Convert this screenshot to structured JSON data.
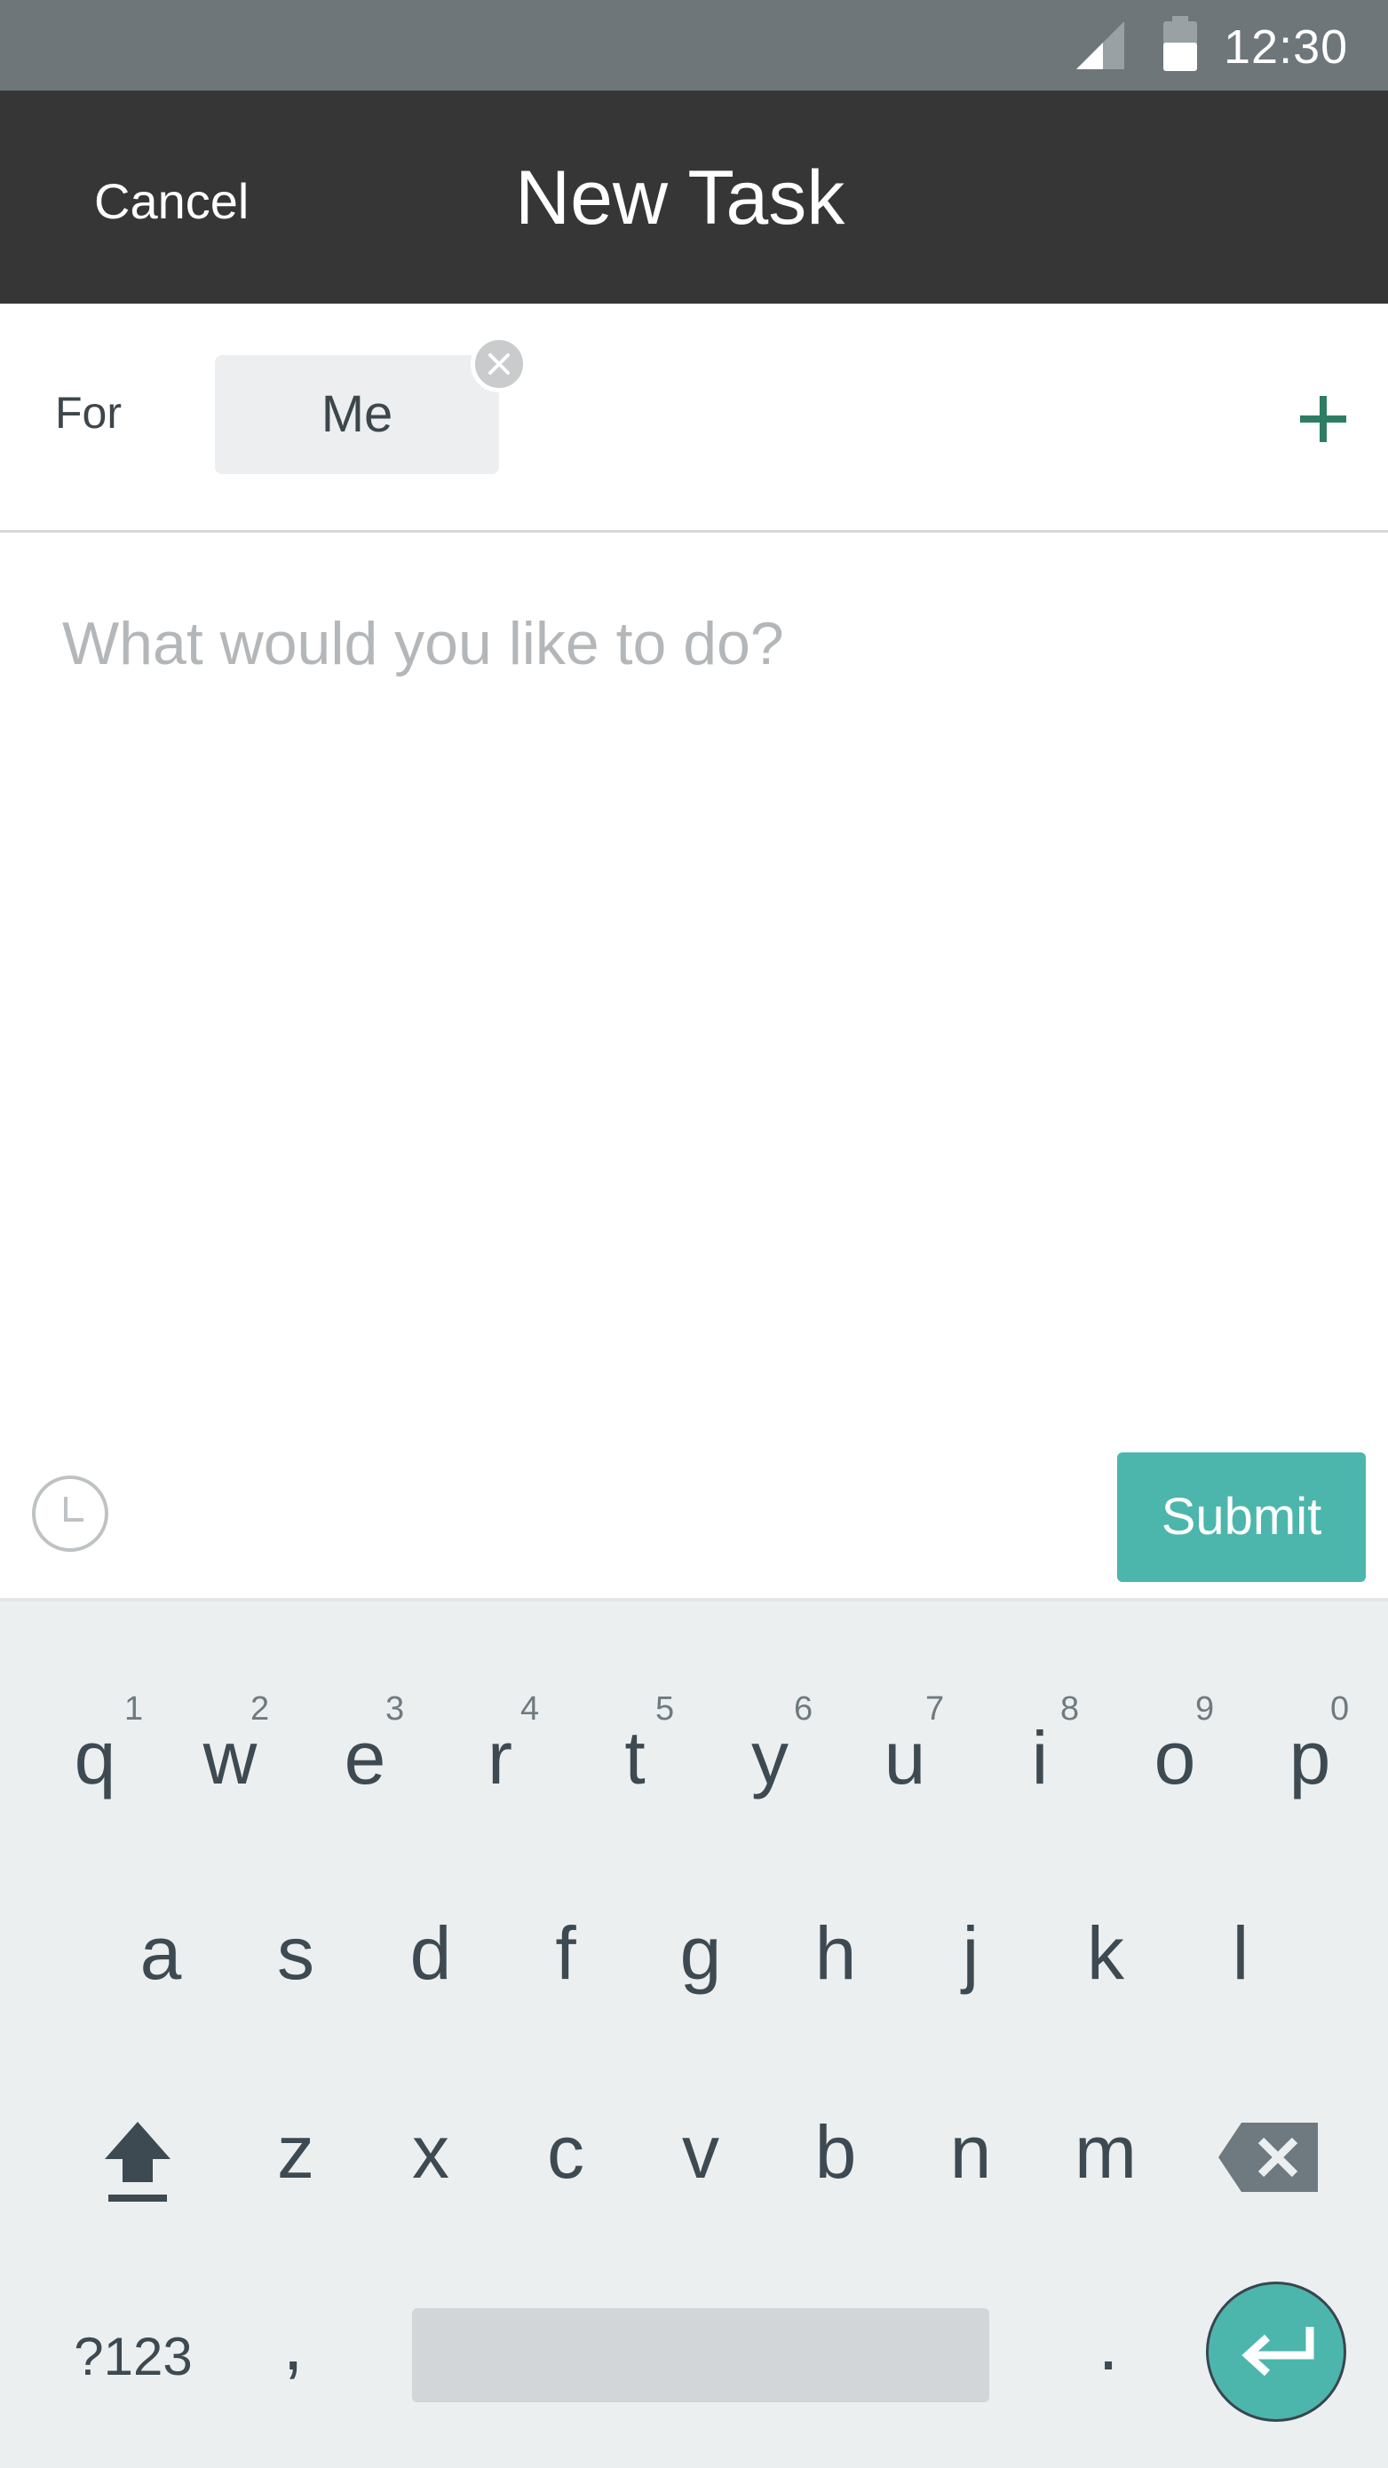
{
  "status_bar": {
    "time": "12:30"
  },
  "app_bar": {
    "cancel_label": "Cancel",
    "title": "New Task"
  },
  "for_row": {
    "label": "For",
    "chip_label": "Me"
  },
  "task": {
    "placeholder": "What would you like to do?",
    "value": ""
  },
  "actions": {
    "submit_label": "Submit"
  },
  "keyboard": {
    "row1": [
      {
        "key": "q",
        "hint": "1"
      },
      {
        "key": "w",
        "hint": "2"
      },
      {
        "key": "e",
        "hint": "3"
      },
      {
        "key": "r",
        "hint": "4"
      },
      {
        "key": "t",
        "hint": "5"
      },
      {
        "key": "y",
        "hint": "6"
      },
      {
        "key": "u",
        "hint": "7"
      },
      {
        "key": "i",
        "hint": "8"
      },
      {
        "key": "o",
        "hint": "9"
      },
      {
        "key": "p",
        "hint": "0"
      }
    ],
    "row2": [
      "a",
      "s",
      "d",
      "f",
      "g",
      "h",
      "j",
      "k",
      "l"
    ],
    "row3": [
      "z",
      "x",
      "c",
      "v",
      "b",
      "n",
      "m"
    ],
    "symbols_label": "?123",
    "comma": ",",
    "period": "."
  },
  "colors": {
    "status_bar": "#6e7679",
    "app_bar": "#363636",
    "accent": "#4db6ac",
    "add_icon": "#2e7d62",
    "keyboard_bg": "#eceff0"
  },
  "icons": {
    "status_bar": [
      "signal-icon",
      "battery-icon"
    ],
    "for_row": [
      "chip-remove-icon",
      "add-icon"
    ],
    "actions": [
      "clock-icon"
    ],
    "keyboard": [
      "shift-icon",
      "backspace-icon",
      "enter-icon"
    ]
  }
}
